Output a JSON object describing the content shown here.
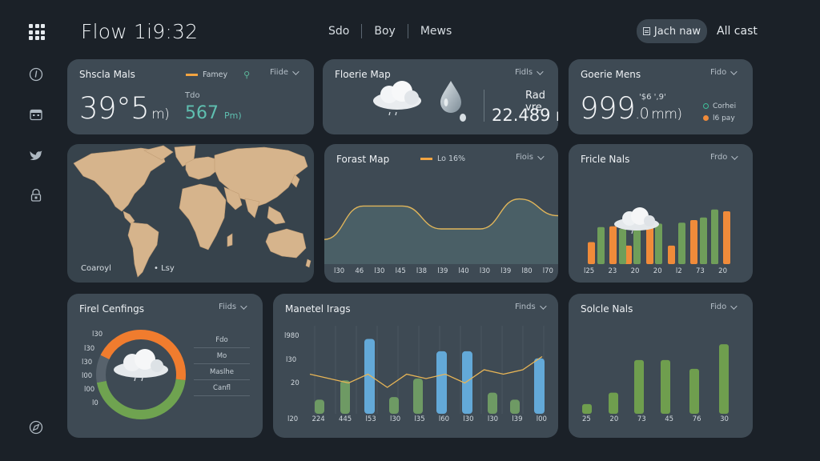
{
  "header": {
    "title": "Flow 1i9:32",
    "nav": [
      "Sdo",
      "Boy",
      "Mews"
    ],
    "action_button": "Jach naw",
    "link": "All cast"
  },
  "cards": {
    "current": {
      "title": "Shscla Mals",
      "legend": "Famey",
      "dropdown": "Fiide",
      "value": "39°5",
      "unit": "m)",
      "sub_label": "Tdo",
      "sub_value": "567",
      "sub_unit": "Pm)"
    },
    "forecast_map": {
      "title": "Floerie Map",
      "dropdown": "Fidls",
      "label": "Rad vre",
      "value": "22.489",
      "unit": "N"
    },
    "gauge": {
      "title": "Goerie Mens",
      "dropdown": "Fido",
      "note": "'$6 ',9'",
      "value": "999",
      "value_decimal": ".0",
      "unit": "mm)",
      "legend": [
        {
          "label": "Corhei",
          "color": "#3fbf9a"
        },
        {
          "label": "l6 pay",
          "color": "#f08b3a"
        }
      ]
    },
    "world_map": {
      "label_left": "Coaroyl",
      "label_right": "• Lsy"
    },
    "forest_map": {
      "title": "Forast Map",
      "legend": "Lo 16%",
      "dropdown": "Fiois",
      "ticks": [
        "l30",
        "46",
        "l30",
        "l45",
        "l38",
        "l39",
        "l40",
        "l30",
        "l39",
        "l80",
        "l70"
      ]
    },
    "fricle": {
      "title": "Fricle Nals",
      "dropdown": "Frdo",
      "ticks": [
        "l25",
        "23",
        "20",
        "20",
        "l2",
        "73",
        "20"
      ]
    },
    "final": {
      "title": "Firel Cenfings",
      "dropdown": "Fiids",
      "yticks": [
        "l30",
        "l30",
        "l30",
        "l00",
        "l00",
        "l0"
      ],
      "list": [
        "Fdo",
        "Mo",
        "Maslhe",
        "Canfl"
      ]
    },
    "metered": {
      "title": "Manetel Irags",
      "dropdown": "Finds",
      "yticks": [
        "l980",
        "l30",
        "20"
      ],
      "ticks": [
        "l20",
        "224",
        "445",
        "l53",
        "l30",
        "l35",
        "l60",
        "l30",
        "l30",
        "l39",
        "l00"
      ]
    },
    "solcle": {
      "title": "Solcle Nals",
      "dropdown": "Fido",
      "ticks": [
        "25",
        "20",
        "73",
        "45",
        "76",
        "30"
      ]
    }
  },
  "chart_data": [
    {
      "type": "line",
      "title": "Forast Map",
      "series": [
        {
          "values": [
            0.28,
            0.66,
            0.66,
            0.4,
            0.4,
            0.74,
            0.55
          ]
        }
      ]
    },
    {
      "type": "bar",
      "title": "Fricle Nals",
      "series": [
        {
          "color": "#f08b3a",
          "values": [
            0.25,
            0.43,
            0.21,
            0.52,
            0.21,
            0.5,
            0.52,
            0.49,
            0.6
          ]
        },
        {
          "color": "#6f9e5a",
          "values": [
            0.42,
            0.4,
            0.42,
            0.46,
            0.47,
            0.53,
            0.62,
            0.55
          ]
        }
      ]
    },
    {
      "type": "bar",
      "title": "Manetel Irags",
      "series": [
        {
          "color": "#63a9d8",
          "values": [
            0.85,
            0.71,
            0.71,
            0.63
          ]
        },
        {
          "color": "#6e9a64",
          "values": [
            0.16,
            0.38,
            0.19,
            0.4,
            0.24,
            0.16,
            0.31
          ]
        },
        {
          "values": [
            0.45,
            0.4,
            0.35,
            0.45,
            0.3,
            0.45,
            0.4,
            0.45,
            0.35,
            0.5,
            0.45,
            0.5,
            0.65
          ]
        }
      ]
    },
    {
      "type": "bar",
      "title": "Solcle Nals",
      "series": [
        {
          "color": "#6f9e4e",
          "values": [
            0.11,
            0.24,
            0.61,
            0.61,
            0.51,
            0.79
          ]
        }
      ]
    },
    {
      "type": "pie",
      "title": "Firel Cenfings",
      "series": [
        {
          "values": [
            0.45,
            0.45,
            0.1
          ]
        }
      ],
      "colors": [
        "#6fa350",
        "#f07c2e",
        "#57626c"
      ]
    }
  ]
}
